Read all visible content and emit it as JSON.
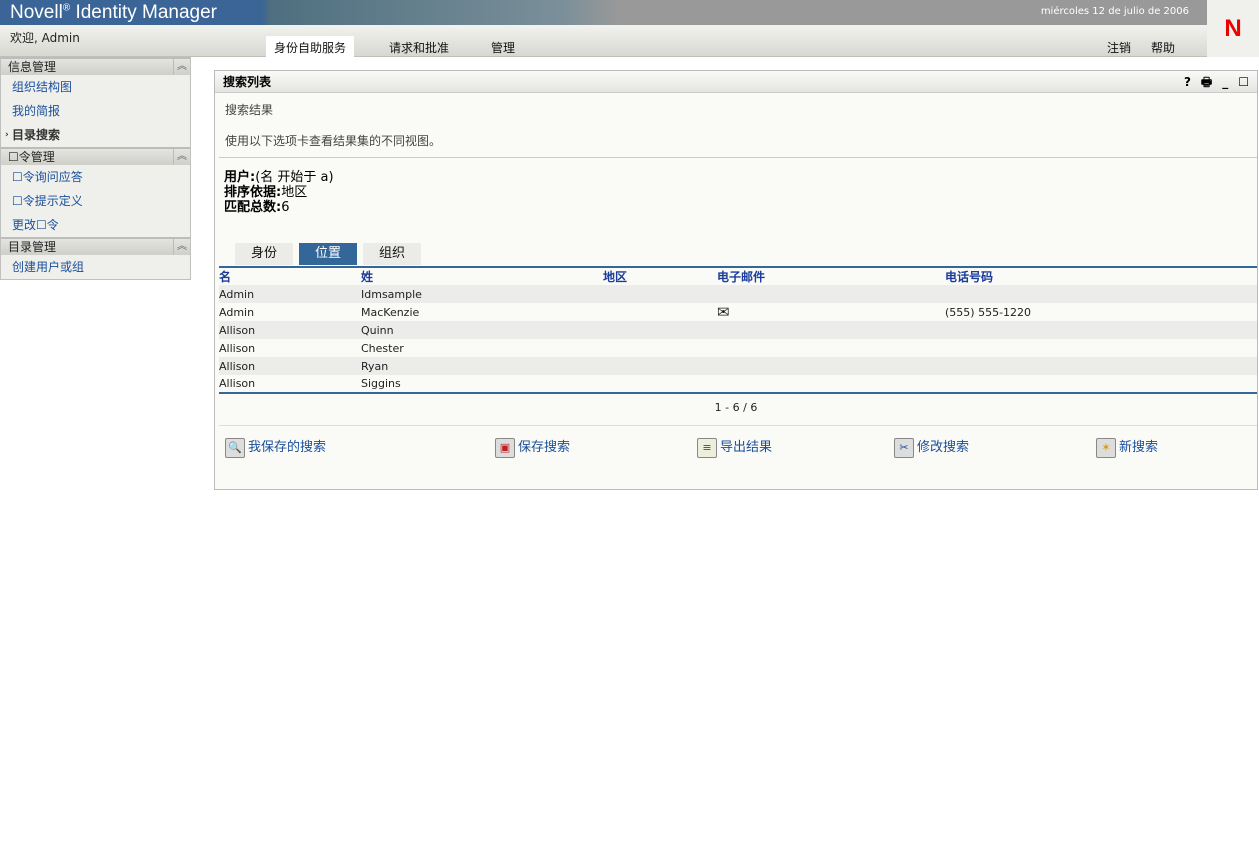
{
  "header": {
    "brand": "Novell",
    "brand_reg": "®",
    "product": " Identity Manager",
    "date": "miércoles 12 de julio de 2006",
    "logo": "N",
    "welcome": "欢迎, Admin",
    "tabs": [
      "身份自助服务",
      "请求和批准",
      "管理"
    ],
    "logout": "注销",
    "help": "帮助"
  },
  "sidebar": {
    "sections": [
      {
        "title": "信息管理",
        "items": [
          "组织结构图",
          "我的简报",
          "目录搜索"
        ]
      },
      {
        "title": "☐令管理",
        "items": [
          "☐令询问应答",
          "☐令提示定义",
          "更改☐令"
        ]
      },
      {
        "title": "目录管理",
        "items": [
          "创建用户或组"
        ]
      }
    ]
  },
  "panel": {
    "title": "搜索列表",
    "subtitle": "搜索结果",
    "hint": "使用以下选项卡查看结果集的不同视图。",
    "user_label": "用户:",
    "user_value": "(名 开始于 a)",
    "sort_label": "排序依据:",
    "sort_value": "地区",
    "count_label": "匹配总数:",
    "count_value": "6",
    "tabs": [
      "身份",
      "位置",
      "组织"
    ],
    "columns": [
      "名",
      "姓",
      "地区",
      "电子邮件",
      "电话号码"
    ],
    "rows": [
      [
        "Admin",
        "Idmsample",
        "",
        "",
        ""
      ],
      [
        "Admin",
        "MacKenzie",
        "",
        "✉",
        "(555) 555-1220"
      ],
      [
        "Allison",
        "Quinn",
        "",
        "",
        ""
      ],
      [
        "Allison",
        "Chester",
        "",
        "",
        ""
      ],
      [
        "Allison",
        "Ryan",
        "",
        "",
        ""
      ],
      [
        "Allison",
        "Siggins",
        "",
        "",
        ""
      ]
    ],
    "pagination": "1 - 6 / 6",
    "actions": [
      "我保存的搜索",
      "保存搜索",
      "导出结果",
      "修改搜索",
      "新搜索"
    ]
  }
}
